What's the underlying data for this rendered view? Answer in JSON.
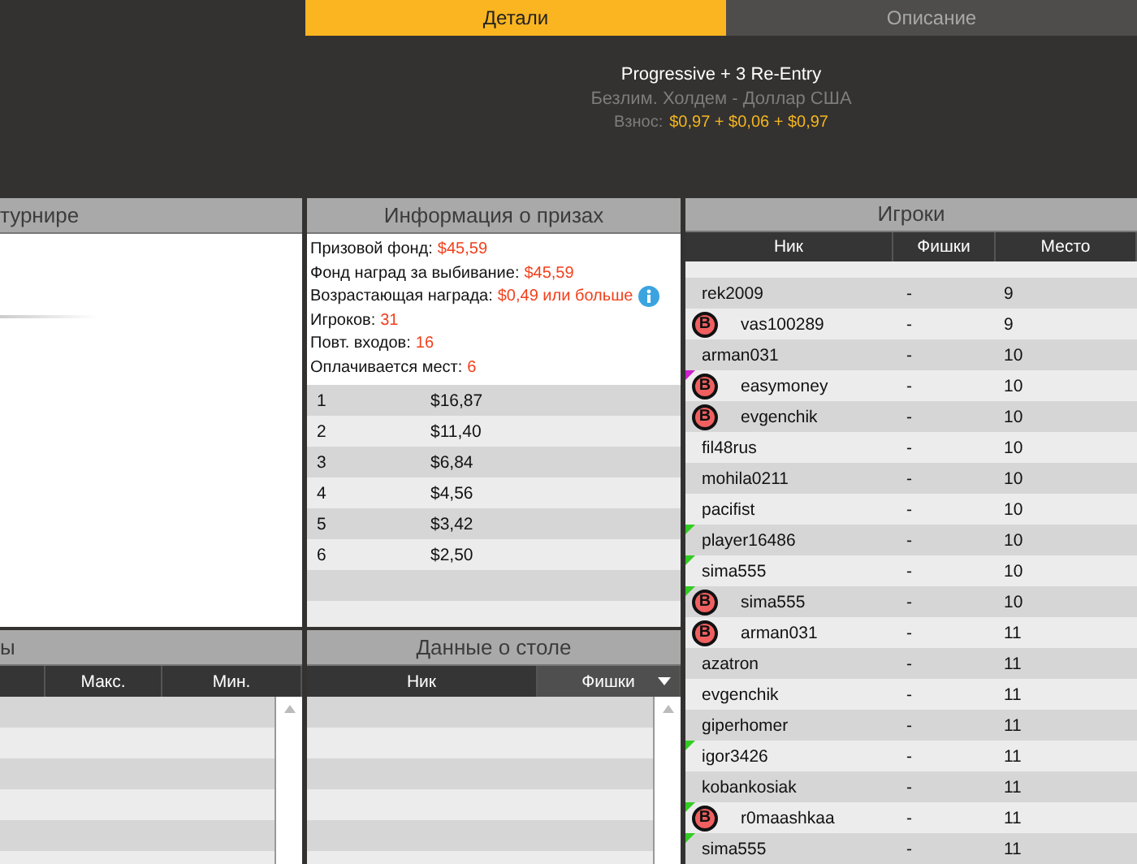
{
  "tabs": [
    {
      "label": "Детали",
      "selected": true
    },
    {
      "label": "Описание",
      "selected": false
    }
  ],
  "tournament": {
    "name": "Progressive + 3 Re-Entry",
    "game": "Безлим. Холдем - Доллар США",
    "buyin_label": "Взнос:",
    "buyin": "$0,97 + $0,06 + $0,97"
  },
  "tournament_panel": {
    "title": "турнире"
  },
  "prize_panel": {
    "title": "Информация о призах",
    "facts": [
      {
        "label": "Призовой фонд:",
        "value": "$45,59",
        "info": false
      },
      {
        "label": "Фонд наград за выбивание:",
        "value": "$45,59",
        "info": false
      },
      {
        "label": "Возрастающая награда:",
        "value": "$0,49 или больше",
        "info": true
      },
      {
        "label": "Игроков:",
        "value": "31",
        "info": false
      },
      {
        "label": "Повт. входов:",
        "value": "16",
        "info": false
      },
      {
        "label": "Оплачивается мест:",
        "value": "6",
        "info": false
      }
    ],
    "payouts": [
      {
        "place": "1",
        "amount": "$16,87"
      },
      {
        "place": "2",
        "amount": "$11,40"
      },
      {
        "place": "3",
        "amount": "$6,84"
      },
      {
        "place": "4",
        "amount": "$4,56"
      },
      {
        "place": "5",
        "amount": "$3,42"
      },
      {
        "place": "6",
        "amount": "$2,50"
      }
    ]
  },
  "levels_panel": {
    "title": "ы",
    "columns": [
      "Макс.",
      "Мин."
    ]
  },
  "table_panel": {
    "title": "Данные о столе",
    "columns": [
      {
        "label": "Ник",
        "sorted": false
      },
      {
        "label": "Фишки",
        "sorted": true
      }
    ]
  },
  "players_panel": {
    "title": "Игроки",
    "columns": [
      "Ник",
      "Фишки",
      "Место"
    ],
    "rows": [
      {
        "nick": "rek2009",
        "chips": "-",
        "place": "9",
        "bounty": false
      },
      {
        "nick": "vas100289",
        "chips": "-",
        "place": "9",
        "bounty": "B"
      },
      {
        "nick": "arman031",
        "chips": "-",
        "place": "10",
        "bounty": false
      },
      {
        "nick": "easymoney",
        "chips": "-",
        "place": "10",
        "bounty": "B",
        "color": "#cc22cc"
      },
      {
        "nick": "evgenchik",
        "chips": "-",
        "place": "10",
        "bounty": "B"
      },
      {
        "nick": "fil48rus",
        "chips": "-",
        "place": "10",
        "bounty": false
      },
      {
        "nick": "mohila0211",
        "chips": "-",
        "place": "10",
        "bounty": false
      },
      {
        "nick": "pacifist",
        "chips": "-",
        "place": "10",
        "bounty": false
      },
      {
        "nick": "player16486",
        "chips": "-",
        "place": "10",
        "bounty": false,
        "color": "#33cc22"
      },
      {
        "nick": "sima555",
        "chips": "-",
        "place": "10",
        "bounty": false,
        "color": "#33cc22"
      },
      {
        "nick": "sima555",
        "chips": "-",
        "place": "10",
        "bounty": "B",
        "color": "#33cc22"
      },
      {
        "nick": "arman031",
        "chips": "-",
        "place": "11",
        "bounty": "B"
      },
      {
        "nick": "azatron",
        "chips": "-",
        "place": "11",
        "bounty": false
      },
      {
        "nick": "evgenchik",
        "chips": "-",
        "place": "11",
        "bounty": false
      },
      {
        "nick": "giperhomer",
        "chips": "-",
        "place": "11",
        "bounty": false
      },
      {
        "nick": "igor3426",
        "chips": "-",
        "place": "11",
        "bounty": false,
        "color": "#33cc22"
      },
      {
        "nick": "kobankosiak",
        "chips": "-",
        "place": "11",
        "bounty": false
      },
      {
        "nick": "r0maashkaa",
        "chips": "-",
        "place": "11",
        "bounty": "B",
        "color": "#33cc22"
      },
      {
        "nick": "sima555",
        "chips": "-",
        "place": "11",
        "bounty": false,
        "color": "#33cc22"
      }
    ]
  }
}
